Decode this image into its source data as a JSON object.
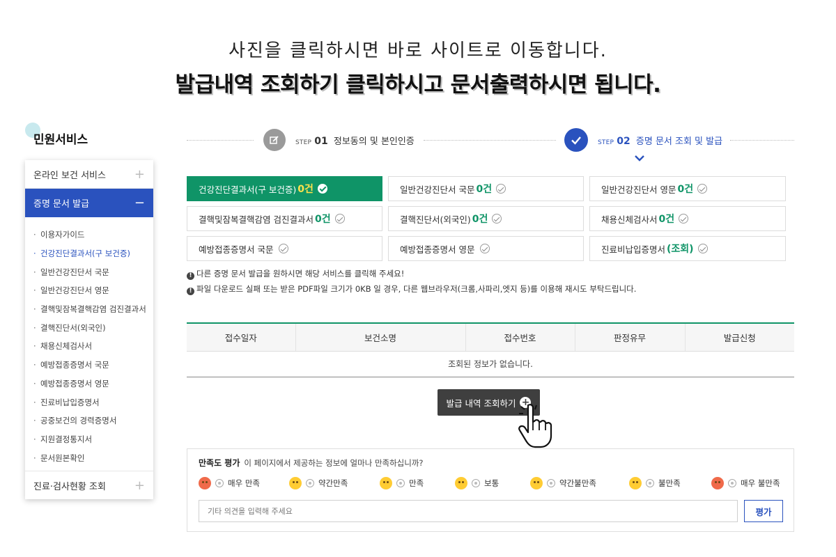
{
  "header": {
    "line1": "사진을 클릭하시면 바로 사이트로 이동합니다.",
    "line2": "발급내역 조회하기 클릭하시고 문서출력하시면 됩니다."
  },
  "sidebar": {
    "title": "민원서비스",
    "menus": [
      {
        "label": "온라인 보건 서비스",
        "toggle": "+"
      },
      {
        "label": "증명 문서 발급",
        "toggle": "−"
      }
    ],
    "sub_items": [
      "이용자가이드",
      "건강진단결과서(구 보건증)",
      "일반건강진단서 국문",
      "일반건강진단서 영문",
      "결핵및잠복결핵감염 검진결과서",
      "결핵진단서(외국인)",
      "채용신체검사서",
      "예방접종증명서 국문",
      "예방접종증명서 영문",
      "진료비납입증명서",
      "공중보건의 경력증명서",
      "지원결정통지서",
      "문서원본확인"
    ],
    "bottom_menu": {
      "label": "진료·검사현황 조회",
      "toggle": "+"
    }
  },
  "steps": {
    "step1": {
      "prefix": "STEP",
      "num": "01",
      "label": "정보동의 및 본인인증"
    },
    "step2": {
      "prefix": "STEP",
      "num": "02",
      "label": "증명 문서 조회 및 발급"
    }
  },
  "documents": [
    {
      "name": "건강진단결과서(구 보건증)",
      "count": "0건",
      "selected": true
    },
    {
      "name": "일반건강진단서 국문",
      "count": "0건"
    },
    {
      "name": "일반건강진단서 영문",
      "count": "0건"
    },
    {
      "name": "결핵및잠복결핵감염 검진결과서",
      "count": "0건"
    },
    {
      "name": "결핵진단서(외국인)",
      "count": "0건"
    },
    {
      "name": "채용신체검사서",
      "count": "0건"
    },
    {
      "name": "예방접종증명서 국문",
      "count": ""
    },
    {
      "name": "예방접종증명서 영문",
      "count": ""
    },
    {
      "name": "진료비납입증명서",
      "count": "(조회)"
    }
  ],
  "notices": [
    "다른 증명 문서 발급을 원하시면 해당 서비스를 클릭해 주세요!",
    "파일 다운로드 실패 또는 받은 PDF파일 크기가 0KB 일 경우, 다른 웹브라우저(크롬,사파리,엣지 등)를 이용해 재시도 부탁드립니다."
  ],
  "table": {
    "headers": [
      "접수일자",
      "보건소명",
      "접수번호",
      "판정유무",
      "발급신청"
    ],
    "empty_message": "조회된 정보가 없습니다."
  },
  "query_button": {
    "label": "발급 내역 조회하기",
    "icon": "plus-circle-icon"
  },
  "survey": {
    "title": "만족도 평가",
    "question": "이 페이지에서 제공하는 정보에 얼마나 만족하십니까?",
    "options": [
      "매우 만족",
      "약간만족",
      "만족",
      "보통",
      "약간불만족",
      "불만족",
      "매우 불만족"
    ],
    "placeholder": "기타 의견을 입력해 주세요",
    "submit_label": "평가"
  },
  "colors": {
    "primary_blue": "#2a52be",
    "green": "#0f9467",
    "dark_button": "#3f3f3f"
  }
}
